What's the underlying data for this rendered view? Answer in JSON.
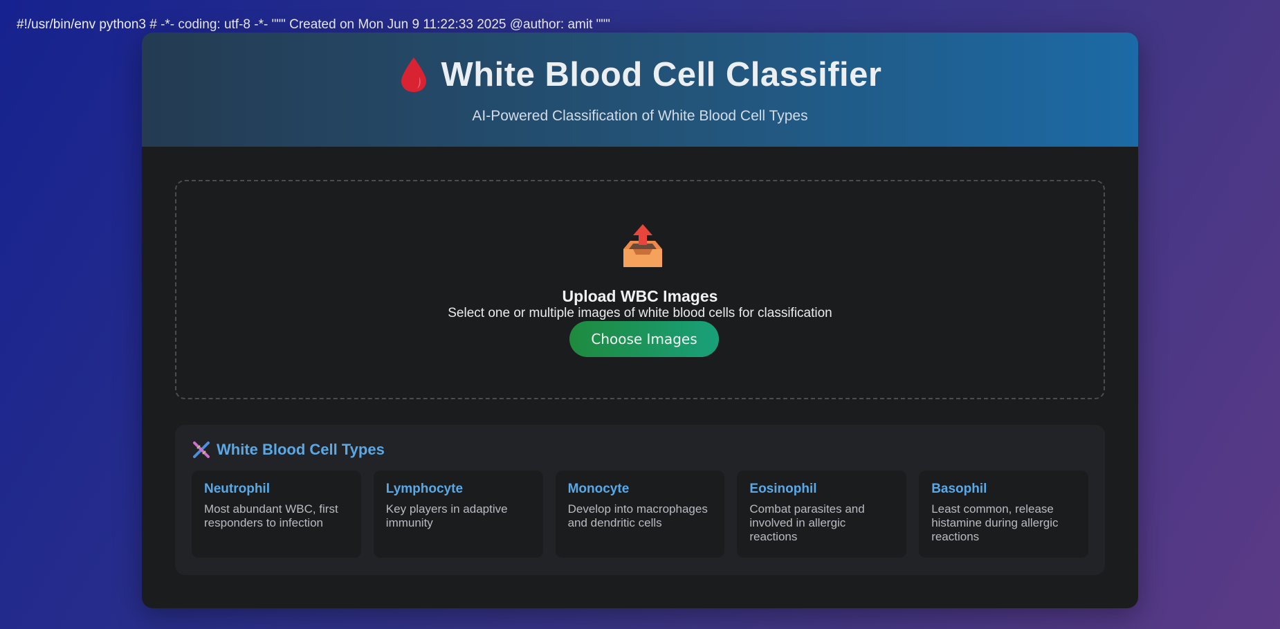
{
  "code_line": "#!/usr/bin/env python3 # -*- coding: utf-8 -*- \"\"\" Created on Mon Jun 9 11:22:33 2025 @author: amit \"\"\"",
  "header": {
    "icon": "blood-drop-icon",
    "title": "White Blood Cell Classifier",
    "subtitle": "AI-Powered Classification of White Blood Cell Types"
  },
  "upload": {
    "icon": "outbox-tray-icon",
    "title": "Upload WBC Images",
    "description": "Select one or multiple images of white blood cells for classification",
    "button_label": "Choose Images"
  },
  "cell_types": {
    "icon": "dna-icon",
    "heading": "White Blood Cell Types",
    "items": [
      {
        "name": "Neutrophil",
        "description": "Most abundant WBC, first responders to infection"
      },
      {
        "name": "Lymphocyte",
        "description": "Key players in adaptive immunity"
      },
      {
        "name": "Monocyte",
        "description": "Develop into macrophages and dendritic cells"
      },
      {
        "name": "Eosinophil",
        "description": "Combat parasites and involved in allergic reactions"
      },
      {
        "name": "Basophil",
        "description": "Least common, release histamine during allergic reactions"
      }
    ]
  },
  "colors": {
    "accent": "#5aa9e6",
    "button_start": "#1f8a3e",
    "button_end": "#19a07a",
    "card_bg": "#1b1c1e"
  }
}
